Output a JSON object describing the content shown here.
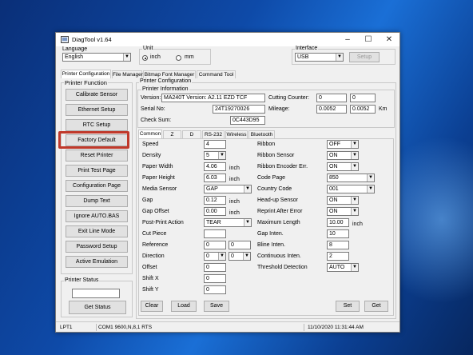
{
  "title": "DiagTool v1.64",
  "language": {
    "label": "Language",
    "value": "English"
  },
  "unit": {
    "label": "Unit",
    "inch": "inch",
    "mm": "mm",
    "selected": "inch"
  },
  "interface": {
    "label": "Interface",
    "value": "USB",
    "setup": "Setup"
  },
  "main_tabs": [
    "Printer Configuration",
    "File Manager",
    "Bitmap Font Manager",
    "Command Tool"
  ],
  "printer_function": {
    "label": "Printer Function",
    "buttons": [
      "Calibrate Sensor",
      "Ethernet Setup",
      "RTC Setup",
      "Factory Default",
      "Reset Printer",
      "Print Test Page",
      "Configuration Page",
      "Dump Text",
      "Ignore AUTO.BAS",
      "Exit Line Mode",
      "Password Setup",
      "Active Emulation"
    ]
  },
  "printer_status": {
    "label": "Printer Status",
    "get_status": "Get Status"
  },
  "printer_config": {
    "label": "Printer Configuration",
    "info_label": "Printer Information",
    "version_label": "Version:",
    "version": "MA240T Version: A2.11 EZD TCF",
    "serial_label": "Serial No:",
    "serial": "24T19270026",
    "checksum_label": "Check Sum:",
    "checksum": "0C443D95",
    "cutting_label": "Cutting Counter:",
    "cutting_1": "0",
    "cutting_2": "0",
    "mileage_label": "Mileage:",
    "mileage_1": "0.0052",
    "mileage_2": "0.0052",
    "mileage_unit": "Km"
  },
  "sub_tabs": [
    "Common",
    "Z",
    "D",
    "RS-232",
    "Wireless",
    "Bluetooth"
  ],
  "left_settings": {
    "speed": {
      "label": "Speed",
      "value": "4"
    },
    "density": {
      "label": "Density",
      "value": "5"
    },
    "paper_width": {
      "label": "Paper Width",
      "value": "4.06",
      "unit": "inch"
    },
    "paper_height": {
      "label": "Paper Height",
      "value": "6.03",
      "unit": "inch"
    },
    "media_sensor": {
      "label": "Media Sensor",
      "value": "GAP"
    },
    "gap": {
      "label": "Gap",
      "value": "0.12",
      "unit": "inch"
    },
    "gap_offset": {
      "label": "Gap Offset",
      "value": "0.00",
      "unit": "inch"
    },
    "post_print": {
      "label": "Post-Print Action",
      "value": "TEAR"
    },
    "cut_piece": {
      "label": "Cut Piece",
      "value": ""
    },
    "reference": {
      "label": "Reference",
      "value1": "0",
      "value2": "0"
    },
    "direction": {
      "label": "Direction",
      "value1": "0",
      "value2": "0"
    },
    "offset": {
      "label": "Offset",
      "value": "0"
    },
    "shift_x": {
      "label": "Shift X",
      "value": "0"
    },
    "shift_y": {
      "label": "Shift Y",
      "value": "0"
    }
  },
  "right_settings": {
    "ribbon": {
      "label": "Ribbon",
      "value": "OFF"
    },
    "ribbon_sensor": {
      "label": "Ribbon Sensor",
      "value": "ON"
    },
    "ribbon_encoder": {
      "label": "Ribbon Encoder Err.",
      "value": "ON"
    },
    "code_page": {
      "label": "Code Page",
      "value": "850"
    },
    "country_code": {
      "label": "Country Code",
      "value": "001"
    },
    "headup_sensor": {
      "label": "Head-up Sensor",
      "value": "ON"
    },
    "reprint": {
      "label": "Reprint After Error",
      "value": "ON"
    },
    "max_length": {
      "label": "Maximum Length",
      "value": "10.00",
      "unit": "inch"
    },
    "gap_inten": {
      "label": "Gap Inten.",
      "value": "10"
    },
    "bline_inten": {
      "label": "Bline Inten.",
      "value": "8"
    },
    "continuous_inten": {
      "label": "Continuous Inten.",
      "value": "2"
    },
    "threshold": {
      "label": "Threshold Detection",
      "value": "AUTO"
    }
  },
  "bottom_buttons": {
    "clear": "Clear",
    "load": "Load",
    "save": "Save",
    "set": "Set",
    "get": "Get"
  },
  "statusbar": {
    "port": "LPT1",
    "comm": "COM1 9600,N,8,1 RTS",
    "datetime": "11/10/2020 11:31:44 AM"
  },
  "colors": {
    "highlight": "#c0392b",
    "desktop": "#0e4aa8"
  }
}
